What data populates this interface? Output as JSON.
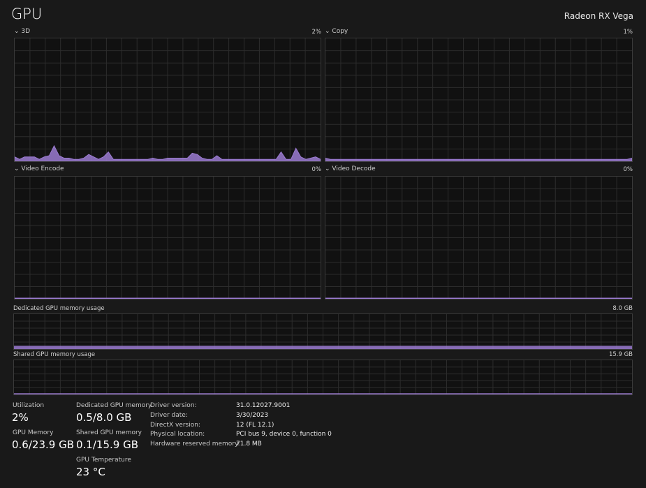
{
  "header": {
    "title": "GPU",
    "device": "Radeon RX Vega"
  },
  "accent": "#9b7bd1",
  "engines": [
    {
      "name": "3D",
      "value": "2%",
      "samples": [
        3,
        1,
        3,
        3,
        3,
        1,
        3,
        4,
        12,
        4,
        2,
        2,
        1,
        1,
        2,
        5,
        3,
        1,
        3,
        7,
        1,
        1,
        1,
        1,
        1,
        1,
        1,
        1,
        2,
        1,
        1,
        2,
        2,
        2,
        2,
        2,
        6,
        5,
        2,
        1,
        1,
        4,
        1,
        1,
        1,
        1,
        1,
        1,
        1,
        1,
        1,
        1,
        1,
        1,
        7,
        1,
        1,
        10,
        3,
        1,
        2,
        3,
        1
      ]
    },
    {
      "name": "Copy",
      "value": "1%",
      "samples": [
        2,
        1,
        1,
        1,
        1,
        1,
        1,
        1,
        1,
        1,
        1,
        1,
        1,
        1,
        1,
        1,
        1,
        1,
        1,
        1,
        1,
        1,
        1,
        1,
        1,
        1,
        1,
        1,
        1,
        1,
        1,
        1,
        1,
        1,
        1,
        1,
        1,
        1,
        1,
        1,
        1,
        1,
        1,
        1,
        1,
        1,
        1,
        1,
        1,
        1,
        1,
        1,
        1,
        1,
        1,
        1,
        1,
        1,
        1,
        1,
        1,
        1,
        2
      ]
    },
    {
      "name": "Video Encode",
      "value": "0%",
      "samples": []
    },
    {
      "name": "Video Decode",
      "value": "0%",
      "samples": []
    }
  ],
  "memory_graphs": [
    {
      "name": "Dedicated GPU memory usage",
      "max": "8.0 GB",
      "level_percent": 6.5
    },
    {
      "name": "Shared GPU memory usage",
      "max": "15.9 GB",
      "level_percent": 0.6
    }
  ],
  "stats": {
    "utilization": {
      "label": "Utilization",
      "value": "2%"
    },
    "gpu_memory": {
      "label": "GPU Memory",
      "value": "0.6/23.9 GB"
    },
    "dedicated": {
      "label": "Dedicated GPU memory",
      "value": "0.5/8.0 GB"
    },
    "shared": {
      "label": "Shared GPU memory",
      "value": "0.1/15.9 GB"
    },
    "temperature": {
      "label": "GPU Temperature",
      "value": "23 °C"
    }
  },
  "details": [
    {
      "key": "Driver version:",
      "value": "31.0.12027.9001"
    },
    {
      "key": "Driver date:",
      "value": "3/30/2023"
    },
    {
      "key": "DirectX version:",
      "value": "12 (FL 12.1)"
    },
    {
      "key": "Physical location:",
      "value": "PCI bus 9, device 0, function 0"
    },
    {
      "key": "Hardware reserved memory:",
      "value": "71.8 MB"
    }
  ]
}
